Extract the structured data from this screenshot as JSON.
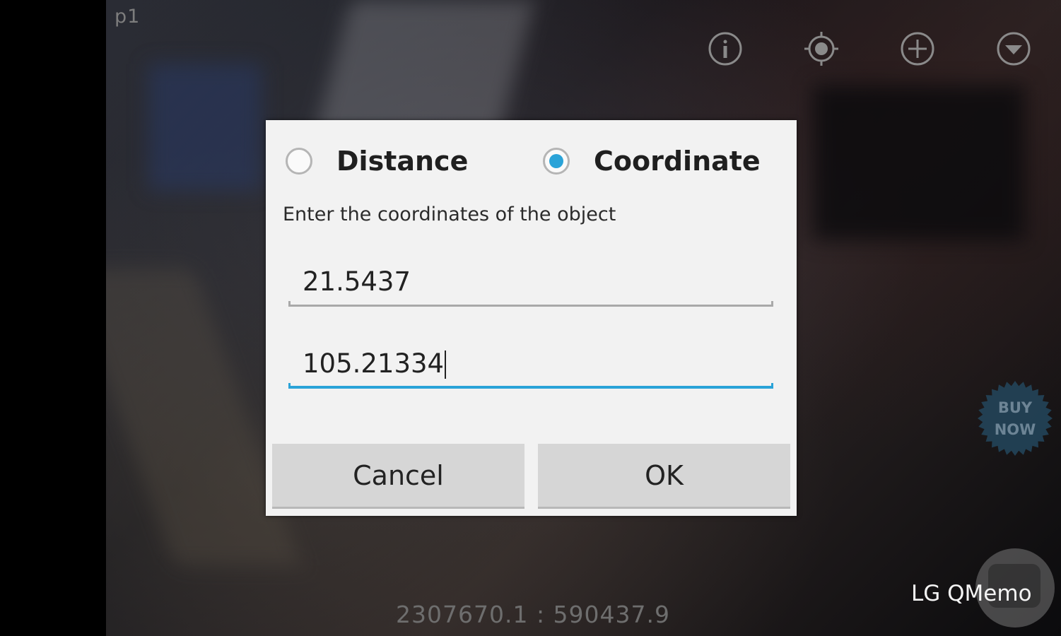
{
  "page_label": "p1",
  "top_toolbar": [
    {
      "icon": "info-icon"
    },
    {
      "icon": "locate-icon"
    },
    {
      "icon": "add-icon"
    },
    {
      "icon": "dropdown-icon"
    }
  ],
  "dialog": {
    "options": [
      {
        "label": "Distance",
        "checked": false
      },
      {
        "label": "Coordinate",
        "checked": true
      }
    ],
    "prompt": "Enter the coordinates of the object",
    "fields": [
      {
        "value": "21.5437",
        "focused": false
      },
      {
        "value": "105.21334",
        "focused": true
      }
    ],
    "buttons": {
      "cancel": "Cancel",
      "ok": "OK"
    }
  },
  "buy_now": {
    "line1": "BUY",
    "line2": "NOW"
  },
  "coordinates_readout": "2307670.1  :  590437.9",
  "qmemo_label": "LG QMemo",
  "colors": {
    "accent": "#2aa3d8",
    "dialog_bg": "#f2f2f2",
    "button_bg": "#d6d6d6"
  }
}
